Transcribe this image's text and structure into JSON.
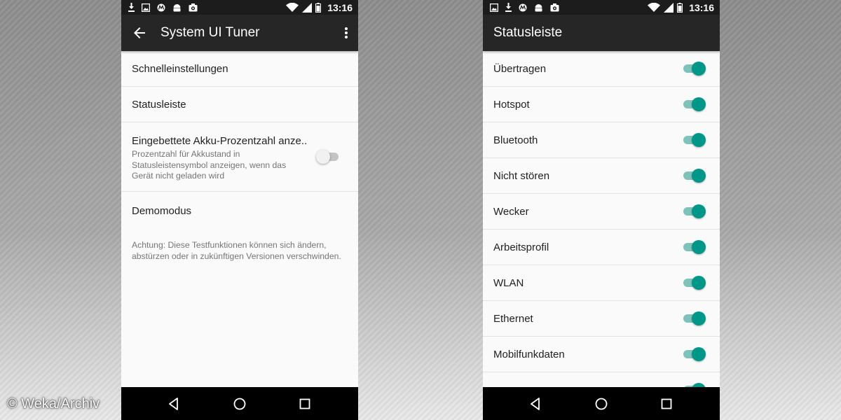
{
  "watermark": "© Weka/Archiv",
  "status_bar": {
    "time": "13:16",
    "icons_left": [
      "download-icon",
      "image-icon",
      "motorola-icon",
      "android-icon",
      "photos-icon"
    ],
    "icons_right": [
      "wifi-icon",
      "signal-icon",
      "battery-icon"
    ]
  },
  "left_screen": {
    "title": "System UI Tuner",
    "items": [
      {
        "label": "Schnelleinstellungen"
      },
      {
        "label": "Statusleiste"
      },
      {
        "label": "Eingebettete Akku-Prozentzahl anze..",
        "summary": "Prozentzahl für Akkustand in Statusleistensymbol anzeigen, wenn das Gerät nicht geladen wird",
        "switch_on": false
      },
      {
        "label": "Demomodus"
      }
    ],
    "footer_note": "Achtung: Diese Testfunktionen können sich ändern, abstürzen oder in zukünftigen Versionen verschwinden."
  },
  "right_screen": {
    "title": "Statusleiste",
    "items": [
      {
        "label": "Übertragen",
        "switch_on": true
      },
      {
        "label": "Hotspot",
        "switch_on": true
      },
      {
        "label": "Bluetooth",
        "switch_on": true
      },
      {
        "label": "Nicht stören",
        "switch_on": true
      },
      {
        "label": "Wecker",
        "switch_on": true
      },
      {
        "label": "Arbeitsprofil",
        "switch_on": true
      },
      {
        "label": "WLAN",
        "switch_on": true
      },
      {
        "label": "Ethernet",
        "switch_on": true
      },
      {
        "label": "Mobilfunkdaten",
        "switch_on": true
      }
    ]
  },
  "colors": {
    "accent": "#009688",
    "accent_track": "#7ec3bb",
    "app_bar": "#262626",
    "status_bar": "#1c1c1c",
    "nav_bar": "#000000",
    "background": "#fafafa"
  }
}
